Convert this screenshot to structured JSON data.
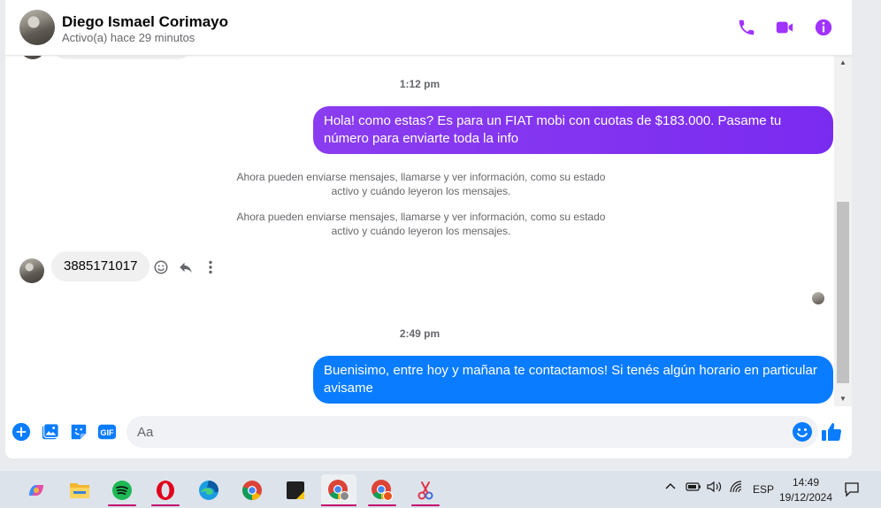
{
  "contact": {
    "name": "Diego Ismael Corimayo",
    "status": "Activo(a) hace 29 minutos"
  },
  "header_icons": [
    "phone-icon",
    "video-icon",
    "info-icon"
  ],
  "messages": {
    "time1": "1:12 pm",
    "out1": "Hola! como estas? Es para un FIAT mobi con cuotas de $183.000. Pasame tu número para enviarte toda la info",
    "sys1": "Ahora pueden enviarse mensajes, llamarse y ver información, como su estado activo y cuándo leyeron los mensajes.",
    "sys2": "Ahora pueden enviarse mensajes, llamarse y ver información, como su estado activo y cuándo leyeron los mensajes.",
    "in1": "3885171017",
    "time2": "2:49 pm",
    "out2": "Buenisimo, entre hoy y mañana te contactamos! Si tenés algún horario en particular avisame"
  },
  "composer": {
    "placeholder": "Aa",
    "gif_label": "GIF"
  },
  "taskbar": {
    "language": "ESP",
    "time": "14:49",
    "date": "19/12/2024"
  },
  "colors": {
    "accent": "#0a7cff",
    "purple": "#8a2be2",
    "header_icon": "#a033ff"
  }
}
